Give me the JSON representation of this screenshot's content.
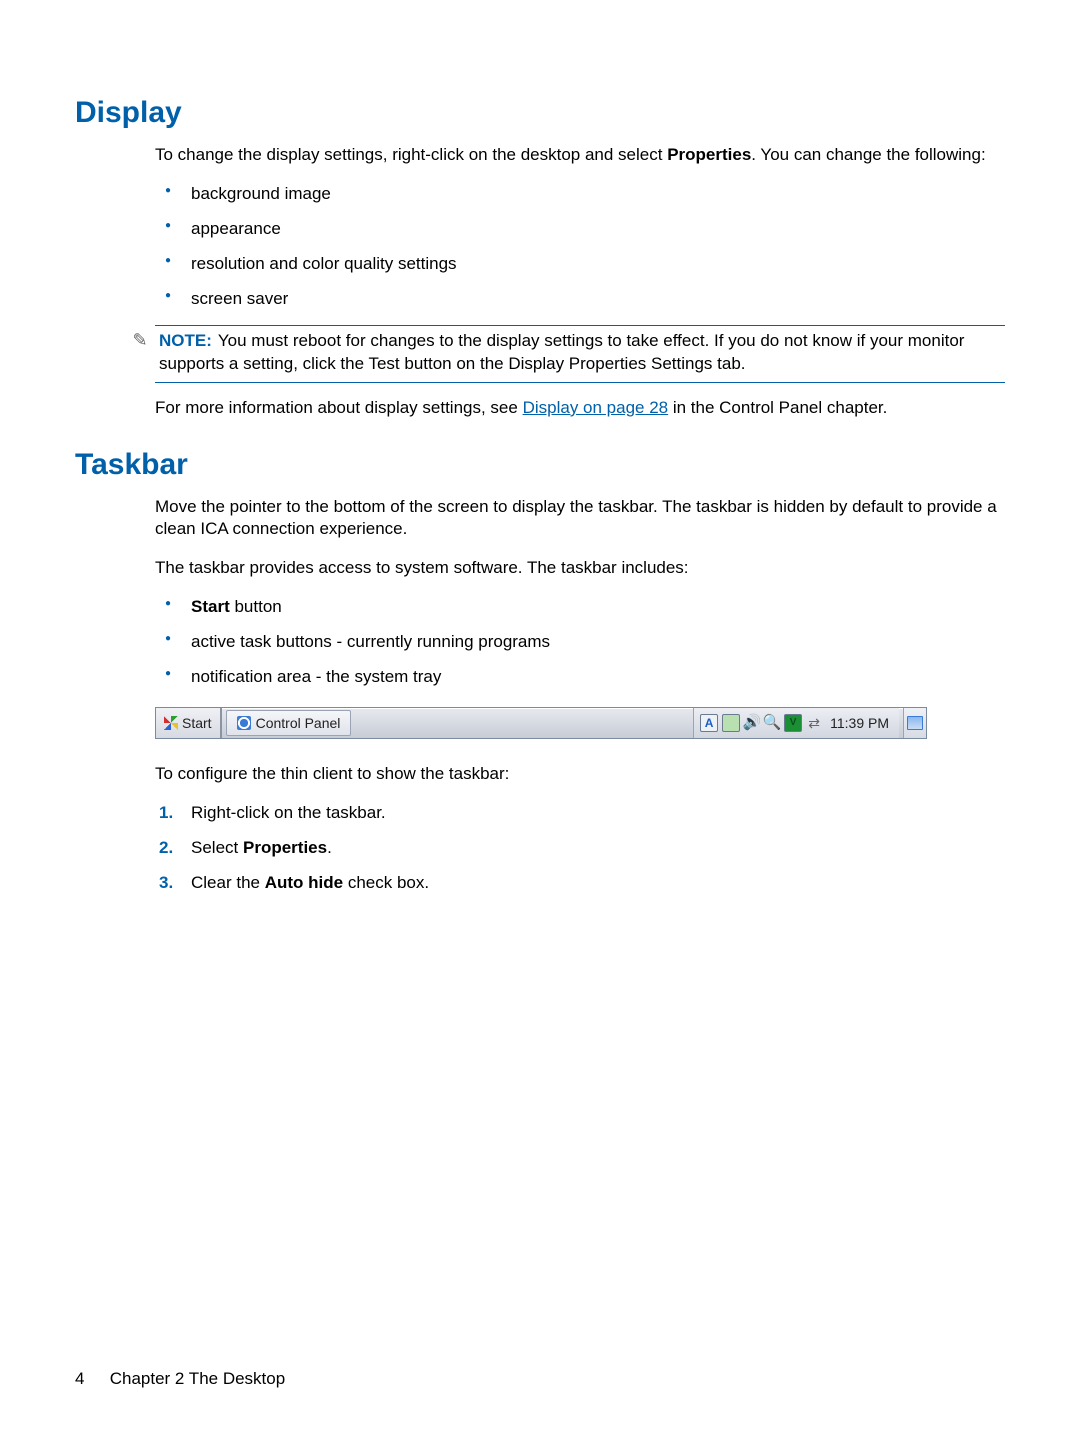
{
  "display": {
    "heading": "Display",
    "intro_pre": "To change the display settings, right-click on the desktop and select ",
    "intro_bold": "Properties",
    "intro_post": ". You can change the following:",
    "bullets": [
      "background image",
      "appearance",
      "resolution and color quality settings",
      "screen saver"
    ],
    "note_label": "NOTE:",
    "note_text": "You must reboot for changes to the display settings to take effect. If you do not know if your monitor supports a setting, click the Test button on the Display Properties Settings tab.",
    "moreinfo_pre": "For more information about display settings, see ",
    "moreinfo_link": "Display on page 28",
    "moreinfo_post": " in the Control Panel chapter."
  },
  "taskbar": {
    "heading": "Taskbar",
    "intro": "Move the pointer to the bottom of the screen to display the taskbar. The taskbar is hidden by default to provide a clean ICA connection experience.",
    "access": "The taskbar provides access to system software. The taskbar includes:",
    "bullets": [
      {
        "bold": "Start",
        "rest": " button"
      },
      {
        "bold": "",
        "rest": "active task buttons - currently running programs"
      },
      {
        "bold": "",
        "rest": "notification area - the system tray"
      }
    ],
    "image": {
      "start_label": "Start",
      "task_label": "Control Panel",
      "time": "11:39 PM"
    },
    "configure_intro": "To configure the thin client to show the taskbar:",
    "steps": [
      {
        "pre": "Right-click on the taskbar.",
        "bold": "",
        "post": ""
      },
      {
        "pre": "Select ",
        "bold": "Properties",
        "post": "."
      },
      {
        "pre": "Clear the ",
        "bold": "Auto hide",
        "post": " check box."
      }
    ]
  },
  "footer": {
    "page": "4",
    "chapter": "Chapter 2   The Desktop"
  }
}
